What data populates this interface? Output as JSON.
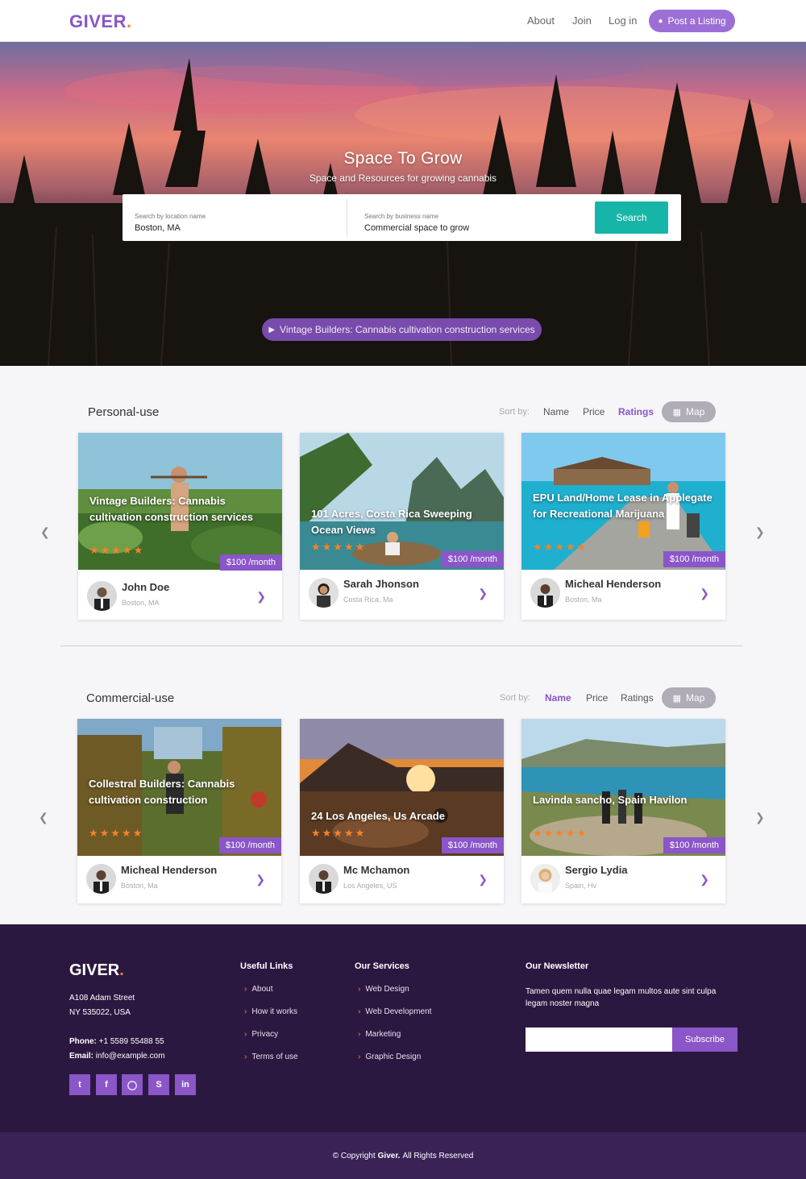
{
  "brand": {
    "name": "GIVER",
    "dot": "."
  },
  "nav": {
    "about": "About",
    "join": "Join",
    "login": "Log in",
    "post_listing": "Post a Listing"
  },
  "hero": {
    "title": "Space To Grow",
    "subtitle": "Space and Resources for growing cannabis",
    "location_label": "Search by location name",
    "location_value": "Boston, MA",
    "business_label": "Search by business name",
    "business_value": "Commercial space to grow",
    "search_button": "Search",
    "featured": "Vintage Builders: Cannabis cultivation construction services"
  },
  "sort": {
    "label": "Sort by:",
    "name": "Name",
    "price": "Price",
    "ratings": "Ratings",
    "map": "Map"
  },
  "personal": {
    "title": "Personal-use",
    "active_sort": "Ratings",
    "cards": [
      {
        "title": "Vintage Builders: Cannabis cultivation construction services",
        "price": "$100 /month",
        "rating": 5,
        "owner": "John Doe",
        "location": "Boston, MA"
      },
      {
        "title": "101 Acres, Costa Rica Sweeping Ocean Views",
        "price": "$100 /month",
        "rating": 5,
        "owner": "Sarah Jhonson",
        "location": "Costa Rica, Ma"
      },
      {
        "title": "EPU Land/Home Lease in Applegate for Recreational Marijuana",
        "price": "$100 /month",
        "rating": 5,
        "owner": "Micheal Henderson",
        "location": "Boston, Ma"
      }
    ]
  },
  "commercial": {
    "title": "Commercial-use",
    "active_sort": "Name",
    "cards": [
      {
        "title": "Collestral Builders: Cannabis cultivation construction",
        "price": "$100 /month",
        "rating": 5,
        "owner": "Micheal Henderson",
        "location": "Boston, Ma"
      },
      {
        "title": "24 Los Angeles, Us Arcade",
        "price": "$100 /month",
        "rating": 5,
        "owner": "Mc Mchamon",
        "location": "Los Angeles, US"
      },
      {
        "title": "Lavinda sancho, Spain Havilon",
        "price": "$100 /month",
        "rating": 5,
        "owner": "Sergio Lydia",
        "location": "Spain, Hv"
      }
    ]
  },
  "stars": "★★★★★",
  "footer": {
    "address1": "A108 Adam Street",
    "address2": "NY 535022, USA",
    "phone_label": "Phone:",
    "phone": "+1 5589 55488 55",
    "email_label": "Email:",
    "email": "info@example.com",
    "useful_title": "Useful Links",
    "useful": [
      "About",
      "How it works",
      "Privacy",
      "Terms of use"
    ],
    "services_title": "Our Services",
    "services": [
      "Web Design",
      "Web Development",
      "Marketing",
      "Graphic Design"
    ],
    "newsletter_title": "Our Newsletter",
    "newsletter_text": "Tamen quem nulla quae legam multos aute sint culpa legam noster magna",
    "subscribe": "Subscribe",
    "social": [
      "twitter-icon",
      "facebook-icon",
      "instagram-icon",
      "skype-icon",
      "linkedin-icon"
    ],
    "copyright_pre": "© Copyright",
    "copyright_brand": "Giver.",
    "copyright_post": "All Rights Reserved"
  },
  "colors": {
    "brand": "#8a56c8",
    "accent": "#f5822a",
    "search": "#17b5a8",
    "footer": "#2b1840"
  }
}
